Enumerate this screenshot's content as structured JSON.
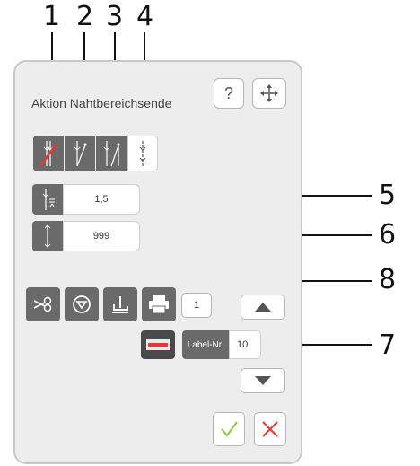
{
  "callouts": {
    "n1": "1",
    "n2": "2",
    "n3": "3",
    "n4": "4",
    "n5": "5",
    "n6": "6",
    "n7": "7",
    "n8": "8"
  },
  "dialog": {
    "title": "Aktion Nahtbereichsende",
    "help_label": "?"
  },
  "fields": {
    "stitch_length_value": "1,5",
    "stitch_count_value": "999"
  },
  "counter": {
    "value": "1"
  },
  "label_field": {
    "label": "Label-Nr.",
    "value": "10"
  },
  "icons": {
    "help": "question-mark-icon",
    "move": "move-cross-icon",
    "mode1": "thread-cut-stitch-icon",
    "mode2": "single-stitch-icon",
    "mode3": "double-stitch-icon",
    "mode4": "dotted-stitch-icon",
    "scissors": "scissors-icon",
    "stop": "stop-icon",
    "foot": "presser-foot-icon",
    "printer": "printer-icon",
    "label_printer": "label-printer-icon",
    "up": "arrow-up-icon",
    "down": "arrow-down-icon",
    "confirm": "checkmark-icon",
    "cancel": "cross-icon"
  },
  "colors": {
    "confirm": "#8cc63f",
    "cancel": "#e53935",
    "dark_button": "#6a6a6a",
    "accent_red": "#e53935"
  }
}
